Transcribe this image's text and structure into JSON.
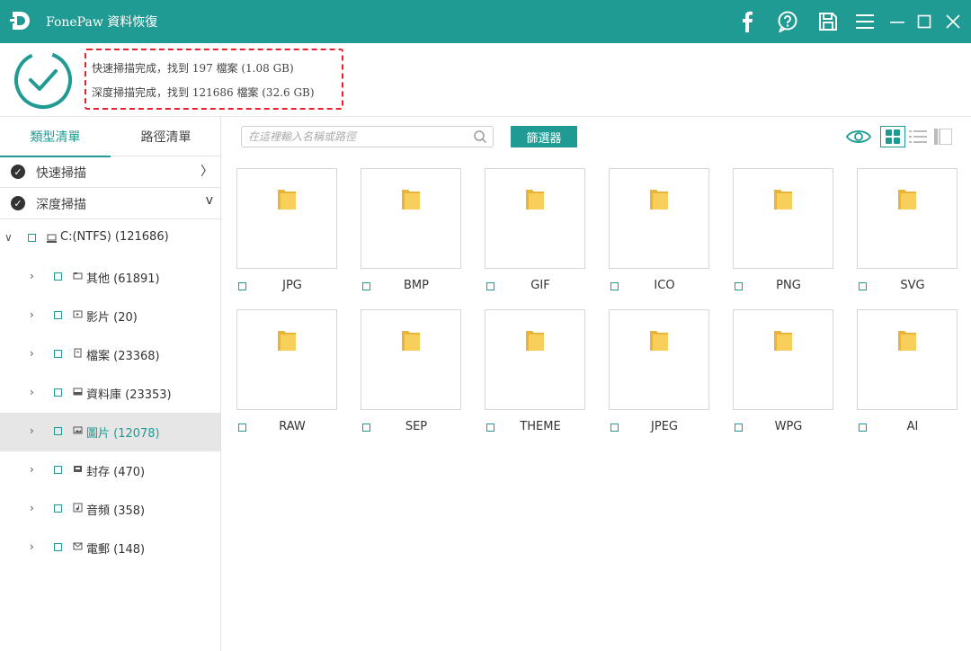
{
  "app": {
    "title": "FonePaw 資料恢復"
  },
  "titlebar_icons": [
    "facebook-icon",
    "help-icon",
    "save-icon",
    "menu-icon",
    "minimize-icon",
    "maximize-icon",
    "close-icon"
  ],
  "status": {
    "quick": "快速掃描完成，找到 197 檔案 (1.08 GB)",
    "deep": "深度掃描完成，找到 121686 檔案 (32.6 GB)"
  },
  "sidebar": {
    "tabs": [
      "類型清單",
      "路徑清單"
    ],
    "active_tab": 0,
    "scans": [
      {
        "label": "快速掃描",
        "arrow": "〉"
      },
      {
        "label": "深度掃描",
        "arrow": "v"
      }
    ],
    "drive": {
      "label": "C:(NTFS) (121686)"
    },
    "categories": [
      {
        "label": "其他 (61891)",
        "icon": "folder-icon"
      },
      {
        "label": "影片 (20)",
        "icon": "video-icon"
      },
      {
        "label": "檔案 (23368)",
        "icon": "document-icon"
      },
      {
        "label": "資料庫  (23353)",
        "icon": "database-icon"
      },
      {
        "label": "圖片 (12078)",
        "icon": "image-icon",
        "selected": true
      },
      {
        "label": "封存 (470)",
        "icon": "archive-icon"
      },
      {
        "label": "音頻 (358)",
        "icon": "audio-icon"
      },
      {
        "label": "電郵 (148)",
        "icon": "email-icon"
      }
    ]
  },
  "toolbar": {
    "search_placeholder": "在這裡輸入名稱或路徑",
    "filter_label": "篩選器",
    "views": [
      "grid-view",
      "list-view",
      "detail-view"
    ],
    "active_view": 0
  },
  "files": [
    "JPG",
    "BMP",
    "GIF",
    "ICO",
    "PNG",
    "SVG",
    "RAW",
    "SEP",
    "THEME",
    "JPEG",
    "WPG",
    "AI"
  ],
  "colors": {
    "accent": "#1f9b94",
    "highlight": "#e8202a",
    "folder": "#f5c542"
  }
}
